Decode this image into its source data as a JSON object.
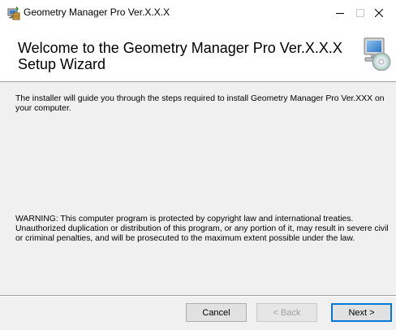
{
  "window": {
    "title": "Geometry Manager Pro Ver.X.X.X"
  },
  "titlebar": {
    "minimize_icon": "minimize-icon",
    "maximize_icon": "maximize-icon",
    "close_icon": "close-icon"
  },
  "header": {
    "title": "Welcome to the Geometry Manager Pro Ver.X.X.X Setup Wizard",
    "graphic_icon": "setup-computer-cd-icon"
  },
  "body": {
    "intro": "The installer will guide you through the steps required to install Geometry Manager Pro Ver.XXX on your computer.",
    "warning": "WARNING: This computer program is protected by copyright law and international treaties. Unauthorized duplication or distribution of this program, or any portion of it, may result in severe civil or criminal penalties, and will be prosecuted to the maximum extent possible under the law."
  },
  "buttons": {
    "cancel": "Cancel",
    "back": "< Back",
    "next": "Next >"
  },
  "colors": {
    "window_bg": "#f0f0f0",
    "header_bg": "#ffffff",
    "default_button_border": "#0078d7",
    "disabled_text": "#a0a0a0"
  }
}
